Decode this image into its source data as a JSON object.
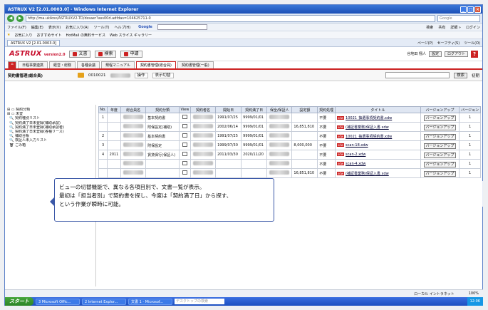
{
  "window": {
    "title": "ASTRUX V2 [2.01.0003.0] - Windows Internet Explorer",
    "url": "http://ma.ukikov/ASTRUXV2-TD/dssaer?ass00d.adfdas=104625711-0",
    "search_placeholder": "Google"
  },
  "ie_menu": {
    "items": [
      "ファイル(F)",
      "編集(E)",
      "表示(V)",
      "お気に入り(A)",
      "ツール(T)",
      "ヘルプ(H)"
    ],
    "google_label": "Google",
    "right_items": [
      "検索",
      "共有",
      "詳細 »",
      "ログイン"
    ]
  },
  "favorites": {
    "items": [
      "お気に入り",
      "おすすめサイト",
      "HotMail の無料サービス",
      "Web スライス ギャラリー"
    ]
  },
  "browser_tab": {
    "label": "ASTRUX V2 [2.01.0003.0]",
    "tools": [
      "ページ(P)",
      "セーフティ(S)",
      "ツール(O)"
    ]
  },
  "app_header": {
    "logo": "ASTRUX",
    "version": "version2.0",
    "buttons": [
      "文書",
      "検索",
      "申請"
    ],
    "user": "谷地田 翔人",
    "right_buttons": [
      "設定",
      "ログアウト"
    ],
    "help": "?"
  },
  "nav_tabs": [
    "日程事業連携",
    "経営・総務",
    "各種会議",
    "規程マニュアル",
    "契約書管理(総合員)",
    "契約書管理(一般)"
  ],
  "toolbar": {
    "title": "契約書管理(総合員)",
    "folder_code": "0010021",
    "ops_label": "操作",
    "view_label": "表示切替",
    "search_button": "検索",
    "clear_button": "初期"
  },
  "sidebar": {
    "items": [
      "契約分類",
      "未登",
      "契約種別リスト",
      "契約満了日未登録(補助承認)",
      "契約満了日未登録(補助承認者)",
      "契約満了日未登録(各種リース)",
      "補助台帳",
      "検証人未入力リスト",
      "ごみ箱"
    ]
  },
  "table": {
    "columns": [
      "No.",
      "年度",
      "総合員名",
      "契約分類",
      "View",
      "契約者名",
      "開始日",
      "契約満了日",
      "保全/保証人",
      "設定額",
      "契約処理",
      "タイトル",
      "バージョンアップ",
      "バージョン"
    ],
    "rows": [
      {
        "no": "1",
        "year": "",
        "category": "基本契約書",
        "start": "1991/07/25",
        "end": "9999/01/01",
        "amount": "",
        "status": "不要",
        "title": "10021_抽選事項契約書.xdw",
        "ver": "1"
      },
      {
        "no": "",
        "year": "",
        "category": "附保設定(補助)",
        "start": "2002/06/14",
        "end": "9999/01/01",
        "amount": "16,851,810",
        "status": "不要",
        "title": "(補証書業務)保証入書.xdw",
        "ver": "1"
      },
      {
        "no": "2",
        "year": "",
        "category": "基本契約書",
        "start": "1991/07/25",
        "end": "9999/01/01",
        "amount": "",
        "status": "不要",
        "title": "10021_抽選事項契約書.xdw",
        "ver": "1"
      },
      {
        "no": "3",
        "year": "",
        "category": "附保設定",
        "start": "1999/07/30",
        "end": "9999/01/01",
        "amount": "8,000,000",
        "status": "不要",
        "title": "scan-18.xdw",
        "ver": "1"
      },
      {
        "no": "4",
        "year": "2011",
        "category": "賃貸保行(保証人)",
        "start": "2011/03/30",
        "end": "2020/11/20",
        "amount": "",
        "status": "不要",
        "title": "scan-2.xdw",
        "ver": "1"
      },
      {
        "no": "",
        "year": "",
        "category": "",
        "start": "",
        "end": "",
        "amount": "",
        "status": "不要",
        "title": "scan-4.xdw",
        "ver": "1"
      },
      {
        "no": "",
        "year": "",
        "category": "",
        "start": "",
        "end": "",
        "amount": "16,851,810",
        "status": "不要",
        "title": "(補証書業務)保証入書.xdw",
        "ver": "1"
      }
    ],
    "version_button": "バージョンアップ",
    "pdf_tag": "xdw"
  },
  "callout": {
    "lines": [
      "ビューの切替機能で、異なる各項目別で、文書一覧が表示。",
      "最初は「担当者別」で契約書を探し、今度は「契約満了日」から探す、",
      "という作業が瞬時に可能。"
    ]
  },
  "statusbar": {
    "zone": "ローカル イントラネット",
    "zoom": "100%"
  },
  "taskbar": {
    "start": "スタート",
    "tasks": [
      "3 Microsoft Offic...",
      "2 Internet Explor...",
      "文書 1 - Microsof..."
    ],
    "search_placeholder": "デスクトップの検索",
    "clock": "12:06"
  }
}
